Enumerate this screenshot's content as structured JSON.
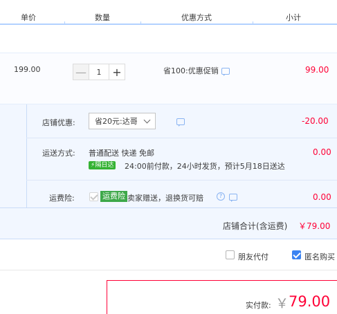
{
  "table_header": {
    "unit_price": "单价",
    "quantity": "数量",
    "promotion": "优惠方式",
    "subtotal": "小计"
  },
  "item": {
    "unit_price": "199.00",
    "quantity": "1",
    "minus_label": "—",
    "plus_label": "+",
    "promotion": "省100:优惠促销",
    "subtotal": "99.00"
  },
  "shop_discount": {
    "label": "店铺优惠:",
    "selected": "省20元:达哥",
    "amount": "-20.00"
  },
  "shipping": {
    "label": "运送方式:",
    "method": "普通配送 快递 免邮",
    "badge": "隔日达",
    "note": "24:00前付款，24小时发货，预计5月18日送达",
    "amount": "0.00"
  },
  "insurance": {
    "label": "运费险:",
    "tag": "运费险",
    "text": "卖家赠送，退换货可赔",
    "amount": "0.00",
    "help": "?"
  },
  "shop_total": {
    "label": "店铺合计(含运费)",
    "amount": "￥79.00"
  },
  "options": {
    "friend_pay": "朋友代付",
    "anonymous": "匿名购买",
    "anonymous_checked": true,
    "friend_pay_checked": false
  },
  "payment": {
    "label": "实付款:",
    "currency": "￥",
    "amount": "79.00"
  },
  "colors": {
    "accent_red": "#ff0036",
    "accent_blue": "#3b83f2",
    "header_line": "#b2d1ff",
    "panel_bg": "#f2f7ff"
  }
}
